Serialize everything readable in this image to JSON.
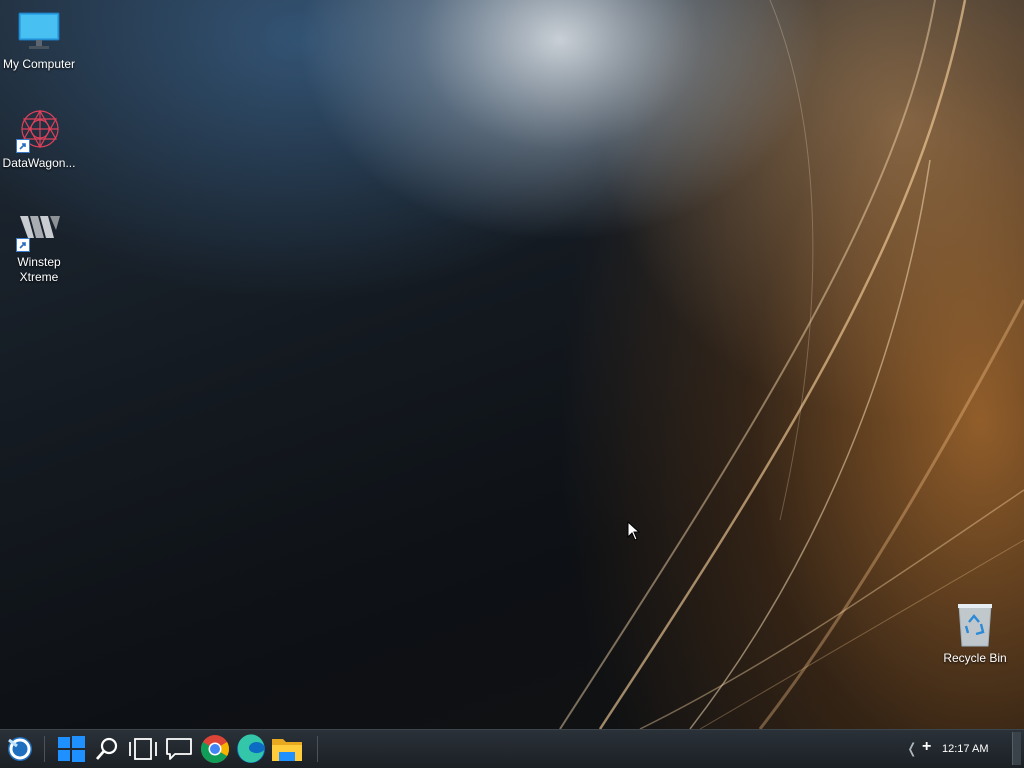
{
  "desktop": {
    "icons": [
      {
        "label": "My Computer",
        "icon": "monitor-icon"
      },
      {
        "label": "DataWagon...",
        "icon": "datawagon-icon"
      },
      {
        "label": "Winstep Xtreme",
        "icon": "winstep-icon"
      },
      {
        "label": "Recycle Bin",
        "icon": "recycle-bin-icon"
      }
    ]
  },
  "taskbar": {
    "buttons": [
      {
        "name": "winstep-start",
        "icon": "winstep-start-icon"
      },
      {
        "name": "windows-start",
        "icon": "windows-logo-icon"
      },
      {
        "name": "search",
        "icon": "search-icon"
      },
      {
        "name": "task-view",
        "icon": "task-view-icon"
      },
      {
        "name": "chat",
        "icon": "chat-icon"
      },
      {
        "name": "chrome",
        "icon": "chrome-icon"
      },
      {
        "name": "edge",
        "icon": "edge-icon"
      },
      {
        "name": "file-explorer",
        "icon": "folder-icon"
      }
    ],
    "tray": {
      "chevron": "❬",
      "plus": "+",
      "clock": "12:17 AM"
    }
  },
  "colors": {
    "taskbar": "#1f252b",
    "accent_blue": "#1a8fe8",
    "windows_blue": "#1e90ff"
  }
}
